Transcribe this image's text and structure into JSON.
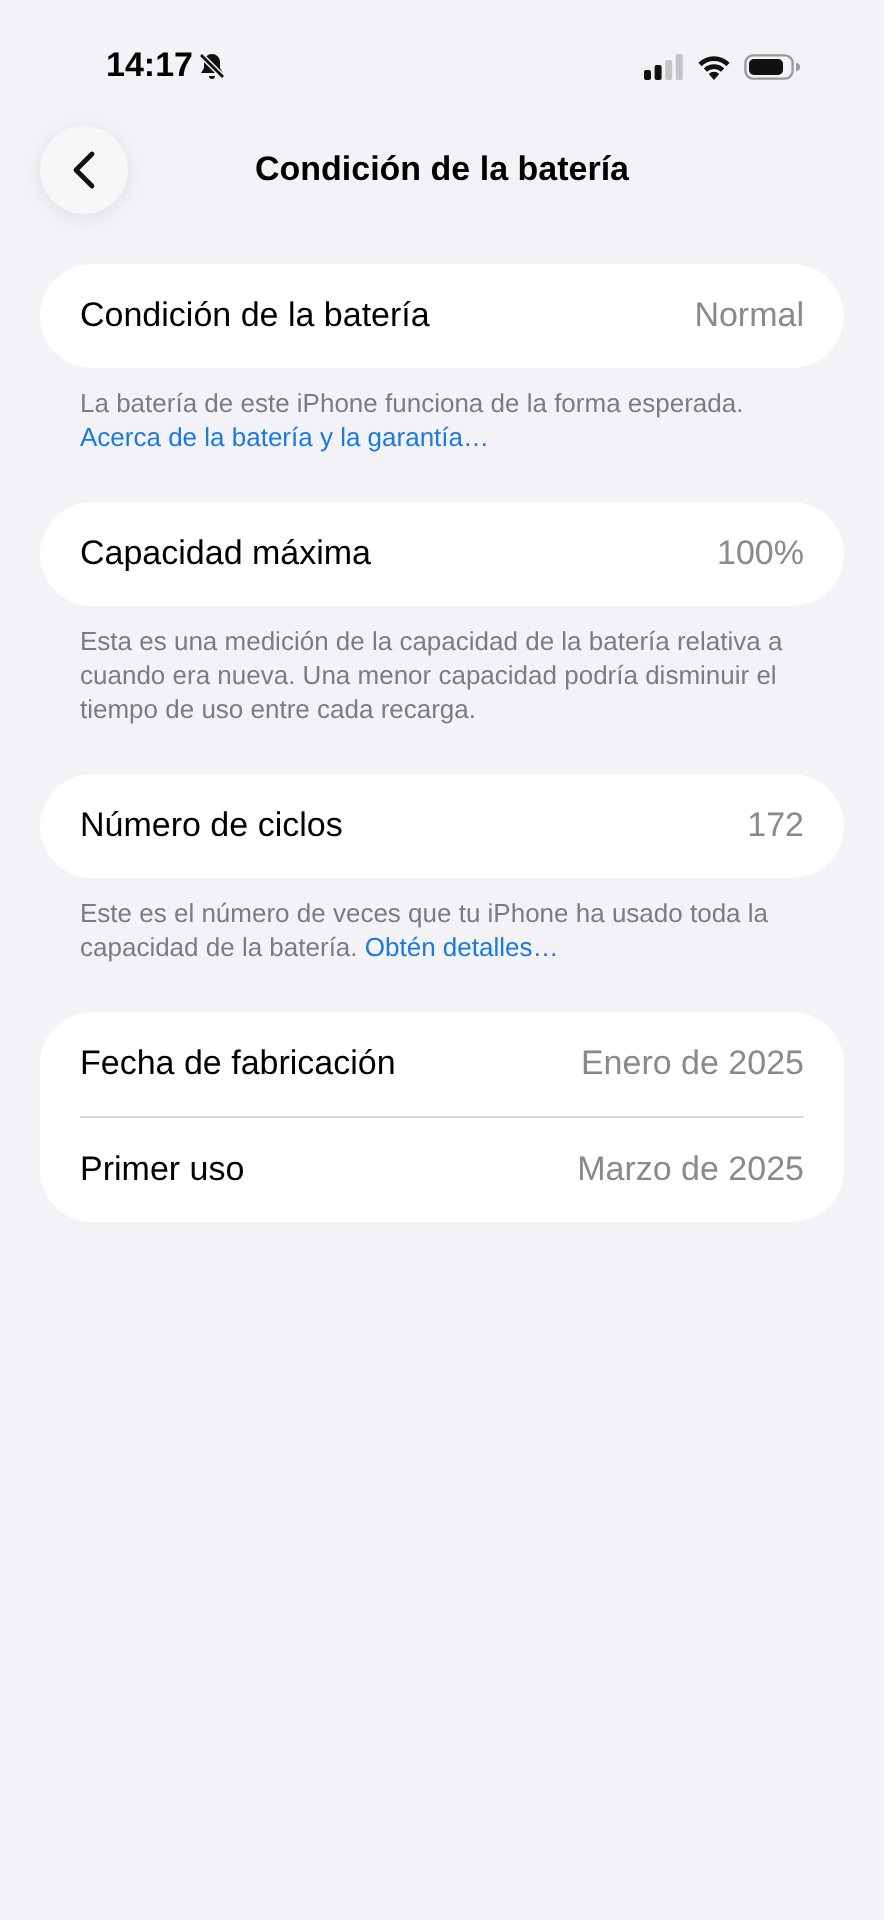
{
  "status_bar": {
    "time": "14:17"
  },
  "nav": {
    "title": "Condición de la batería"
  },
  "groups": [
    {
      "rows": [
        {
          "label": "Condición de la batería",
          "value": "Normal"
        }
      ],
      "footnote": {
        "text": "La batería de este iPhone funciona de la forma esperada.",
        "link": "Acerca de la batería y la garantía…"
      }
    },
    {
      "rows": [
        {
          "label": "Capacidad máxima",
          "value": "100%"
        }
      ],
      "footnote": {
        "text": "Esta es una medición de la capacidad de la batería relativa a cuando era nueva. Una menor capacidad podría disminuir el tiempo de uso entre cada recarga."
      }
    },
    {
      "rows": [
        {
          "label": "Número de ciclos",
          "value": "172"
        }
      ],
      "footnote": {
        "text": "Este es el número de veces que tu iPhone ha usado toda la capacidad de la batería.",
        "link": "Obtén detalles…"
      }
    },
    {
      "rows": [
        {
          "label": "Fecha de fabricación",
          "value": "Enero de 2025"
        },
        {
          "label": "Primer uso",
          "value": "Marzo de 2025"
        }
      ]
    }
  ]
}
